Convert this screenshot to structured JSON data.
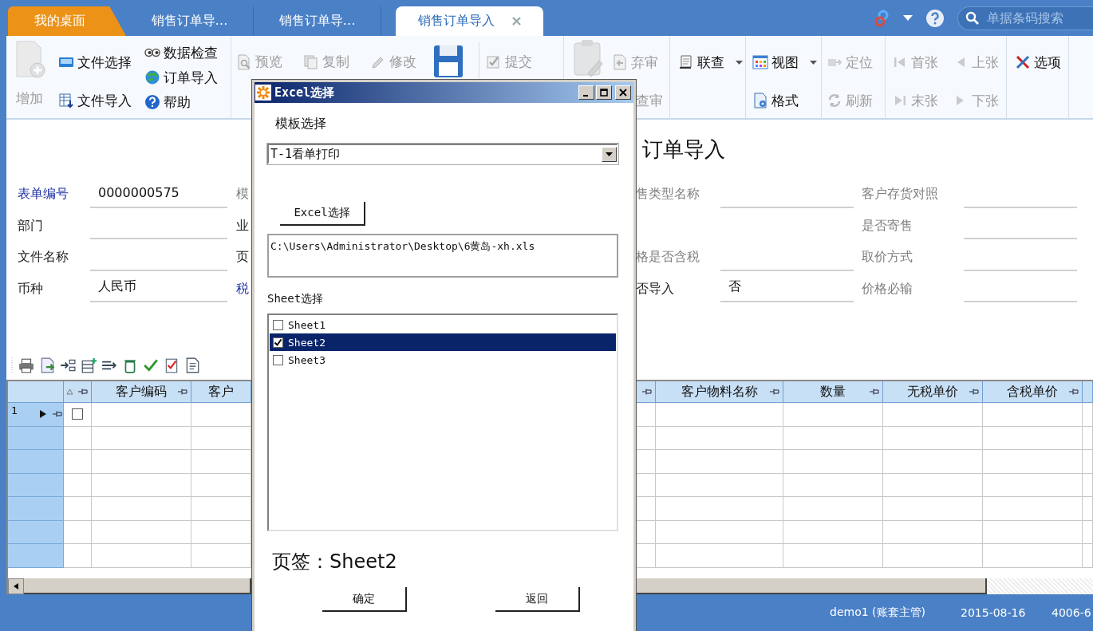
{
  "tabs": [
    {
      "label": "我的桌面",
      "kind": "home",
      "selected": false
    },
    {
      "label": "销售订单导…",
      "kind": "doc",
      "selected": false
    },
    {
      "label": "销售订单导…",
      "kind": "doc",
      "selected": false
    },
    {
      "label": "销售订单导入",
      "kind": "doc",
      "selected": true
    }
  ],
  "search": {
    "placeholder": "单据条码搜索"
  },
  "toolbar": [
    [
      {
        "label": "增加",
        "kind": "large",
        "disabled": true
      }
    ],
    [
      {
        "label": "文件选择",
        "kind": "small",
        "disabled": false
      },
      {
        "label": "文件导入",
        "kind": "small",
        "disabled": false
      }
    ],
    [
      {
        "label": "数据检查",
        "kind": "small",
        "disabled": false
      },
      {
        "label": "订单导入",
        "kind": "small",
        "disabled": false
      },
      {
        "label": "帮助",
        "kind": "small",
        "disabled": false
      }
    ],
    [
      {
        "label": "预览",
        "kind": "small",
        "disabled": true
      },
      {
        "label": "复制",
        "kind": "small",
        "disabled": true
      },
      {
        "label": "修改",
        "kind": "small",
        "disabled": true
      },
      {
        "kind": "large",
        "disabled": false
      },
      {
        "label": "提交",
        "kind": "small",
        "disabled": true
      }
    ],
    [
      {
        "kind": "large",
        "disabled": true
      },
      {
        "label": "弃审",
        "kind": "small",
        "disabled": true
      },
      {
        "label": "查审",
        "kind": "small",
        "disabled": true
      }
    ],
    [
      {
        "label": "联查",
        "kind": "small",
        "disabled": false,
        "dropdown": true
      }
    ],
    [
      {
        "label": "视图",
        "kind": "small",
        "disabled": false,
        "dropdown": true
      },
      {
        "label": "格式",
        "kind": "small",
        "disabled": false
      }
    ],
    [
      {
        "label": "定位",
        "kind": "small",
        "disabled": true
      },
      {
        "label": "刷新",
        "kind": "small",
        "disabled": true
      }
    ],
    [
      {
        "label": "首张",
        "kind": "small",
        "disabled": true
      },
      {
        "label": "上张",
        "kind": "small",
        "disabled": true
      },
      {
        "label": "末张",
        "kind": "small",
        "disabled": true
      },
      {
        "label": "下张",
        "kind": "small",
        "disabled": true
      }
    ],
    [
      {
        "label": "选项",
        "kind": "small",
        "disabled": false
      }
    ]
  ],
  "title": "订单导入",
  "form_rows": [
    {
      "field_1": {
        "label": "表单编号",
        "kind": "required",
        "value": "0000000575"
      },
      "field_2": {
        "label": "模",
        "kind": "readonly"
      },
      "field_3": {
        "label": "售类型名称",
        "kind": "readonly"
      },
      "field_4": {
        "label": "客户存货对照",
        "kind": "readonly"
      }
    },
    {
      "field_1": {
        "label": "部门",
        "kind": "normal"
      },
      "field_2": {
        "label": "业",
        "kind": "normal"
      },
      "field_4": {
        "label": "是否寄售",
        "kind": "readonly"
      }
    },
    {
      "field_1": {
        "label": "文件名称",
        "kind": "normal"
      },
      "field_2": {
        "label": "页",
        "kind": "normal"
      },
      "field_3": {
        "label": "格是否含税",
        "kind": "readonly"
      },
      "field_4": {
        "label": "取价方式",
        "kind": "readonly"
      }
    },
    {
      "field_1": {
        "label": "币种",
        "kind": "normal",
        "value": "人民币"
      },
      "field_2": {
        "label": "税",
        "kind": "required"
      },
      "field_3": {
        "label": "否导入",
        "kind": "normal",
        "value": "否"
      },
      "field_4": {
        "label": "价格必输",
        "kind": "readonly"
      }
    }
  ],
  "grid": {
    "left_columns": [
      {
        "pin": false
      },
      {
        "pin": true,
        "sort": true
      },
      {
        "label": "客户编码",
        "pin": true
      },
      {
        "label": "客户",
        "pin": false
      }
    ],
    "right_columns": [
      {
        "pin": true
      },
      {
        "label": "客户物料名称",
        "pin": true
      },
      {
        "label": "数量",
        "pin": true
      },
      {
        "label": "无税单价",
        "pin": true
      },
      {
        "label": "含税单价",
        "pin": true
      },
      {
        "pin": false
      }
    ],
    "rows": [
      {
        "number": "1",
        "current": true,
        "checked": false
      }
    ]
  },
  "status_bar": [
    "demo1 (账套主管)",
    "2015-08-16",
    "4006-6"
  ],
  "dialog": {
    "title": "Excel选择",
    "template_label": "模板选择",
    "template_value": "T-1看单打印",
    "browse_button": "Excel选择",
    "path": "C:\\Users\\Administrator\\Desktop\\6黄岛-xh.xls",
    "sheet_label": "Sheet选择",
    "sheets": [
      {
        "name": "Sheet1",
        "checked": false,
        "selected": false
      },
      {
        "name": "Sheet2",
        "checked": true,
        "selected": true
      },
      {
        "name": "Sheet3",
        "checked": false,
        "selected": false
      }
    ],
    "tab_label": "页签：Sheet2",
    "buttons": [
      "确定",
      "返回"
    ]
  }
}
